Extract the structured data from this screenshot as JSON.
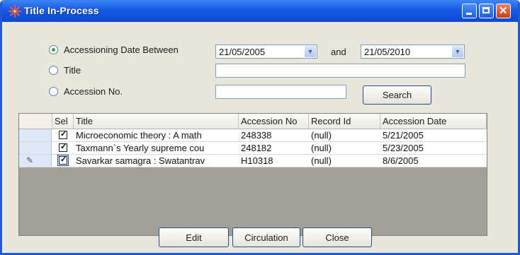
{
  "window": {
    "title": "Title In-Process"
  },
  "search": {
    "option_date_label": "Accessioning Date Between",
    "date_from": "21/05/2005",
    "and_label": "and",
    "date_to": "21/05/2010",
    "option_title_label": "Title",
    "title_value": "",
    "option_accession_label": "Accession No.",
    "accession_value": "",
    "search_button": "Search",
    "selected_option": "Accessioning Date Between"
  },
  "grid": {
    "columns": [
      "Sel",
      "Title",
      "Accession No",
      "Record Id",
      "Accession Date"
    ],
    "rows": [
      {
        "selected": true,
        "title": "Microeconomic theory : A math",
        "accession_no": "248338",
        "record_id": "(null)",
        "accession_date": "5/21/2005"
      },
      {
        "selected": true,
        "title": "Taxmann`s Yearly supreme cou",
        "accession_no": "248182",
        "record_id": "(null)",
        "accession_date": "5/23/2005"
      },
      {
        "selected": true,
        "title": "Savarkar samagra : Swatantrav",
        "accession_no": "H10318",
        "record_id": "(null)",
        "accession_date": "8/6/2005"
      }
    ]
  },
  "actions": {
    "edit": "Edit",
    "circulation": "Circulation",
    "close": "Close"
  },
  "icons": {
    "app": "sparkle-icon",
    "edit_row": "pencil-icon",
    "dropdown": "chevron-down-icon"
  },
  "colors": {
    "titlebar": "#1559e4",
    "window_bg": "#e9e6dc",
    "grid_bg": "#a3a09a",
    "radio_dot": "#3da23d"
  }
}
